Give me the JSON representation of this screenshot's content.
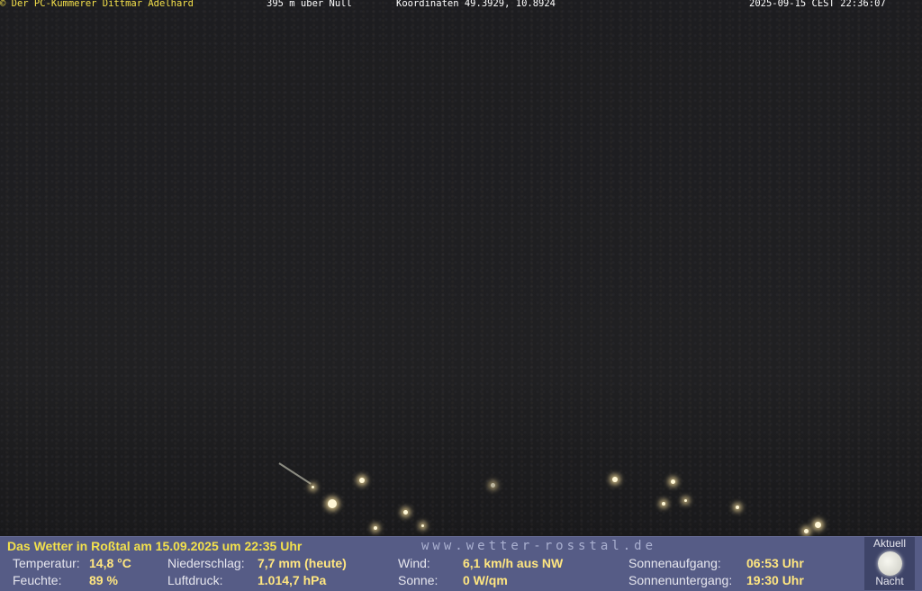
{
  "overlay": {
    "copyright": "© Der PC-Kümmerer Dittmar Adelhard",
    "altitude": "395 m über Null",
    "coordinates": "Koordinaten 49.3929, 10.8924",
    "timestamp": "2025-09-15 CEST 22:36:07"
  },
  "weather": {
    "title": "Das Wetter in Roßtal am 15.09.2025 um 22:35 Uhr",
    "website": "www.wetter-rosstal.de",
    "temperature_label": "Temperatur:",
    "temperature_value": "14,8 °C",
    "humidity_label": "Feuchte:",
    "humidity_value": "89 %",
    "precip_label": "Niederschlag:",
    "precip_value": "7,7 mm (heute)",
    "pressure_label": "Luftdruck:",
    "pressure_value": "1.014,7 hPa",
    "wind_label": "Wind:",
    "wind_value": "6,1 km/h aus NW",
    "sun_label": "Sonne:",
    "sun_value": "0 W/qm",
    "sunrise_label": "Sonnenaufgang:",
    "sunrise_value": "06:53 Uhr",
    "sunset_label": "Sonnenuntergang:",
    "sunset_value": "19:30 Uhr",
    "moon_top": "Aktuell",
    "moon_bottom": "Nacht",
    "moon_icon": "full-moon-icon"
  }
}
